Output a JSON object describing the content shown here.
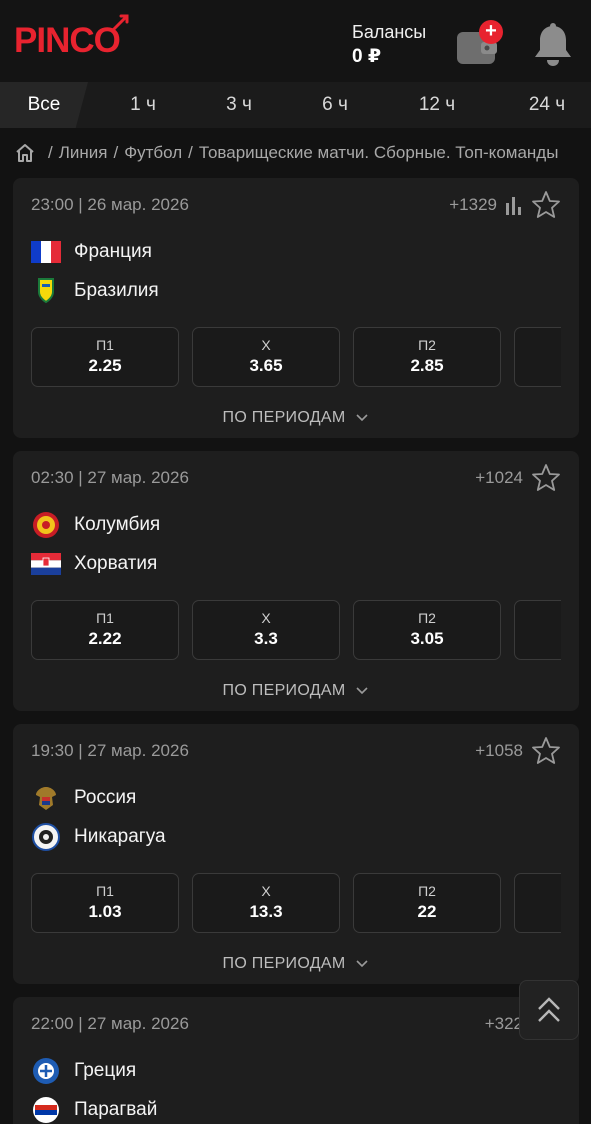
{
  "header": {
    "logo": "PINCO",
    "balance_label": "Балансы",
    "balance_value": "0 ₽",
    "wallet_badge": "+"
  },
  "tabs": [
    "Все",
    "1 ч",
    "3 ч",
    "6 ч",
    "12 ч",
    "24 ч"
  ],
  "breadcrumb": [
    "Линия",
    "Футбол",
    "Товарищеские матчи. Сборные. Топ-команды"
  ],
  "matches": [
    {
      "date": "23:00 | 26 мар. 2026",
      "count": "+1329",
      "home": "Франция",
      "away": "Бразилия",
      "odds": [
        {
          "label": "П1",
          "value": "2.25"
        },
        {
          "label": "Х",
          "value": "3.65"
        },
        {
          "label": "П2",
          "value": "2.85"
        }
      ],
      "periods": "ПО ПЕРИОДАМ"
    },
    {
      "date": "02:30 | 27 мар. 2026",
      "count": "+1024",
      "home": "Колумбия",
      "away": "Хорватия",
      "odds": [
        {
          "label": "П1",
          "value": "2.22"
        },
        {
          "label": "Х",
          "value": "3.3"
        },
        {
          "label": "П2",
          "value": "3.05"
        }
      ],
      "periods": "ПО ПЕРИОДАМ"
    },
    {
      "date": "19:30 | 27 мар. 2026",
      "count": "+1058",
      "home": "Россия",
      "away": "Никарагуа",
      "odds": [
        {
          "label": "П1",
          "value": "1.03"
        },
        {
          "label": "Х",
          "value": "13.3"
        },
        {
          "label": "П2",
          "value": "22"
        }
      ],
      "periods": "ПО ПЕРИОДАМ"
    },
    {
      "date": "22:00 | 27 мар. 2026",
      "count": "+322",
      "home": "Греция",
      "away": "Парагвай"
    }
  ],
  "colors": {
    "accent": "#e8232f",
    "background": "#121212",
    "card": "#1e1e1e"
  }
}
